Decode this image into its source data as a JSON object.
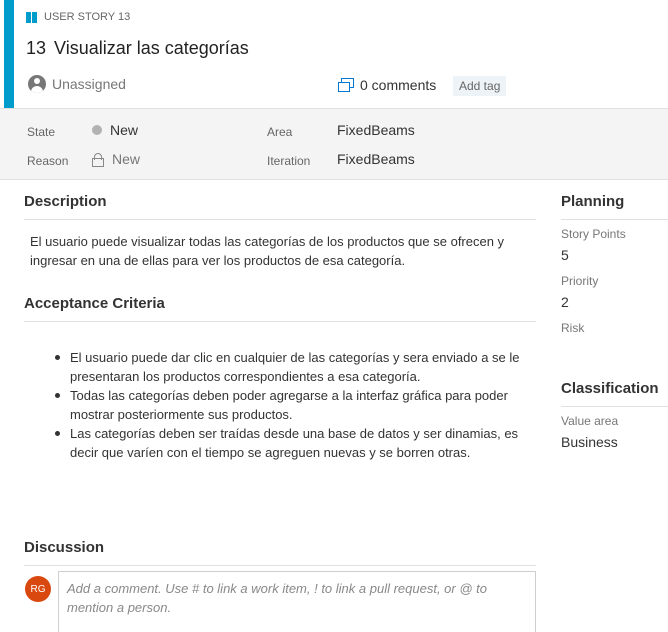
{
  "header": {
    "work_item_type": "USER STORY 13",
    "id": "13",
    "title": "Visualizar las categorías",
    "assignee": "Unassigned",
    "comments_label": "0 comments",
    "add_tag_label": "Add tag",
    "accent_color": "#009ccc"
  },
  "fields": {
    "state_label": "State",
    "state_value": "New",
    "reason_label": "Reason",
    "reason_value": "New",
    "area_label": "Area",
    "area_value": "FixedBeams",
    "iteration_label": "Iteration",
    "iteration_value": "FixedBeams"
  },
  "description": {
    "heading": "Description",
    "text": "El usuario puede visualizar todas las categorías de los productos que se ofrecen y ingresar en una de ellas para ver los productos de esa categoría."
  },
  "acceptance": {
    "heading": "Acceptance Criteria",
    "items": [
      "El usuario puede dar clic en cualquier de las categorías y sera enviado a se le presentaran los productos correspondientes a esa categoría.",
      "Todas las categorías deben poder agregarse a la interfaz gráfica para poder mostrar posteriormente sus productos.",
      "Las categorías deben ser traídas desde una base de datos y ser dinamias, es decir que varíen con el tiempo se agreguen nuevas y se borren otras."
    ]
  },
  "discussion": {
    "heading": "Discussion",
    "avatar_initials": "RG",
    "avatar_color": "#d9480f",
    "placeholder": "Add a comment. Use # to link a work item, ! to link a pull request, or @ to mention a person."
  },
  "planning": {
    "heading": "Planning",
    "story_points_label": "Story Points",
    "story_points_value": "5",
    "priority_label": "Priority",
    "priority_value": "2",
    "risk_label": "Risk"
  },
  "classification": {
    "heading": "Classification",
    "value_area_label": "Value area",
    "value_area_value": "Business"
  }
}
